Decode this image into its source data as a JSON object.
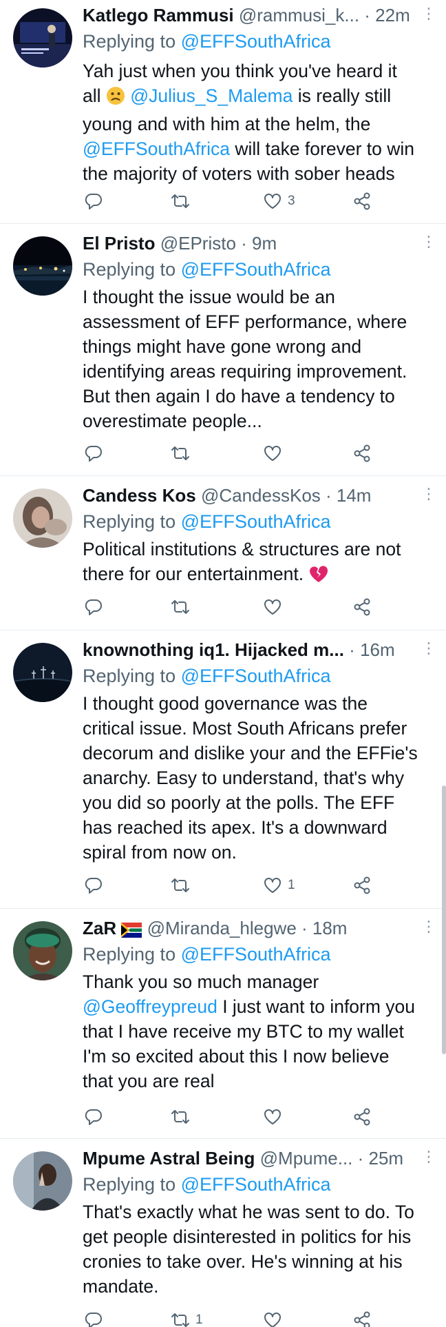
{
  "tweets": [
    {
      "name": "Katlego Rammusi",
      "handle": "@rammusi_k...",
      "sep": " · ",
      "time": "22m",
      "reply_prefix": "Replying to ",
      "reply_to": "@EFFSouthAfrica",
      "lines": [
        {
          "a": "Yah just when you think you've heard it"
        },
        {
          "a": "all ",
          "emoji": "slightly-frowning-face",
          "m": "@Julius_S_Malema",
          "b": "  is really still"
        },
        {
          "a": "young and with him at the helm,  the"
        },
        {
          "m": "@EFFSouthAfrica",
          "b": "  will take forever to win"
        },
        {
          "a": "the majority of voters with sober heads"
        }
      ],
      "likes": "3",
      "retweets": ""
    },
    {
      "name": "El Pristo",
      "handle": "@EPristo",
      "sep": " · ",
      "time": "9m",
      "reply_prefix": "Replying to ",
      "reply_to": "@EFFSouthAfrica",
      "lines": [
        {
          "a": "I thought the issue would be an"
        },
        {
          "a": "assessment of EFF performance, where"
        },
        {
          "a": "things might have gone wrong and"
        },
        {
          "a": "identifying areas requiring improvement."
        },
        {
          "a": "But then again I do have a tendency to"
        },
        {
          "a": "overestimate people..."
        }
      ],
      "likes": "",
      "retweets": ""
    },
    {
      "name": "Candess Kos",
      "handle": "@CandessKos",
      "sep": " · ",
      "time": "14m",
      "reply_prefix": "Replying to ",
      "reply_to": "@EFFSouthAfrica",
      "lines": [
        {
          "a": "Political institutions & structures are not"
        },
        {
          "a": "there for our entertainment. ",
          "emoji": "broken-heart"
        }
      ],
      "likes": "",
      "retweets": ""
    },
    {
      "name": "knownothing iq1. Hijacked m...",
      "handle": "",
      "sep": " · ",
      "time": "16m",
      "reply_prefix": "Replying to ",
      "reply_to": "@EFFSouthAfrica",
      "lines": [
        {
          "a": "I thought good governance was the"
        },
        {
          "a": "critical issue. Most South Africans prefer"
        },
        {
          "a": "decorum and dislike your and the EFFie's"
        },
        {
          "a": "anarchy. Easy to understand, that's why"
        },
        {
          "a": "you did so poorly at the polls. The EFF"
        },
        {
          "a": "has reached its apex. It's a downward"
        },
        {
          "a": "spiral from now on."
        }
      ],
      "likes": "1",
      "retweets": ""
    },
    {
      "name": "ZaR",
      "flag": "south-africa-flag",
      "handle": "@Miranda_hlegwe",
      "sep": " · ",
      "time": "18m",
      "reply_prefix": "Replying to ",
      "reply_to": "@EFFSouthAfrica",
      "lines": [
        {
          "a": "Thank you so much manager"
        },
        {
          "m": "@Geoffreypreud",
          "b": " I just want to inform you"
        },
        {
          "a": "that I have receive my BTC to my wallet"
        },
        {
          "a": "I'm so excited about this I now believe"
        },
        {
          "a": "that you are real"
        }
      ],
      "likes": "",
      "retweets": ""
    },
    {
      "name": "Mpume Astral Being",
      "handle": "@Mpume...",
      "sep": " · ",
      "time": "25m",
      "reply_prefix": "Replying to ",
      "reply_to": "@EFFSouthAfrica",
      "lines": [
        {
          "a": "That's exactly what he was sent to do. To"
        },
        {
          "a": "get people disinterested in politics for his"
        },
        {
          "a": "cronies to take over. He's winning at his"
        },
        {
          "a": "mandate."
        }
      ],
      "likes": "",
      "retweets": "1"
    }
  ],
  "icons": {
    "reply": "reply-icon",
    "retweet": "retweet-icon",
    "like": "like-icon",
    "share": "share-icon",
    "more": "more-icon"
  },
  "colors": {
    "mention": "#1d9bf0",
    "secondary_text": "#536471",
    "divider": "#e6ecf0"
  }
}
